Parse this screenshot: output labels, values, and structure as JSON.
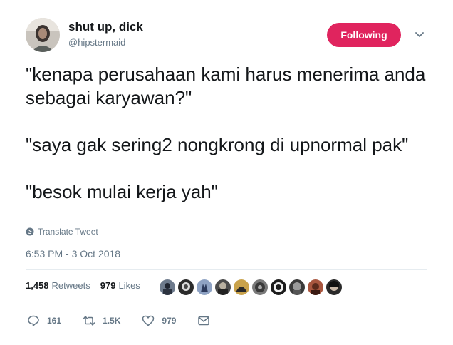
{
  "user": {
    "name": "shut up, dick",
    "handle": "@hipstermaid"
  },
  "follow_button": {
    "label": "Following",
    "color": "#e0245e"
  },
  "tweet": {
    "paragraphs": [
      "\"kenapa perusahaan kami harus menerima anda sebagai karyawan?\"",
      "\"saya gak sering2 nongkrong di upnormal pak\"",
      "\"besok mulai kerja yah\""
    ]
  },
  "translate_label": "Translate Tweet",
  "timestamp": "6:53 PM - 3 Oct 2018",
  "stats": {
    "retweets_count": "1,458",
    "retweets_label": "Retweets",
    "likes_count": "979",
    "likes_label": "Likes"
  },
  "liker_avatars": [
    "avatar-1",
    "avatar-2",
    "avatar-3",
    "avatar-4",
    "avatar-5",
    "avatar-6",
    "avatar-7",
    "avatar-8",
    "avatar-9",
    "avatar-10"
  ],
  "actions": {
    "reply_count": "161",
    "retweet_count": "1.5K",
    "like_count": "979"
  },
  "icons": {
    "reply": "reply-icon",
    "retweet": "retweet-icon",
    "like": "heart-icon",
    "dm": "envelope-icon",
    "globe": "globe-icon",
    "caret": "chevron-down-icon"
  }
}
